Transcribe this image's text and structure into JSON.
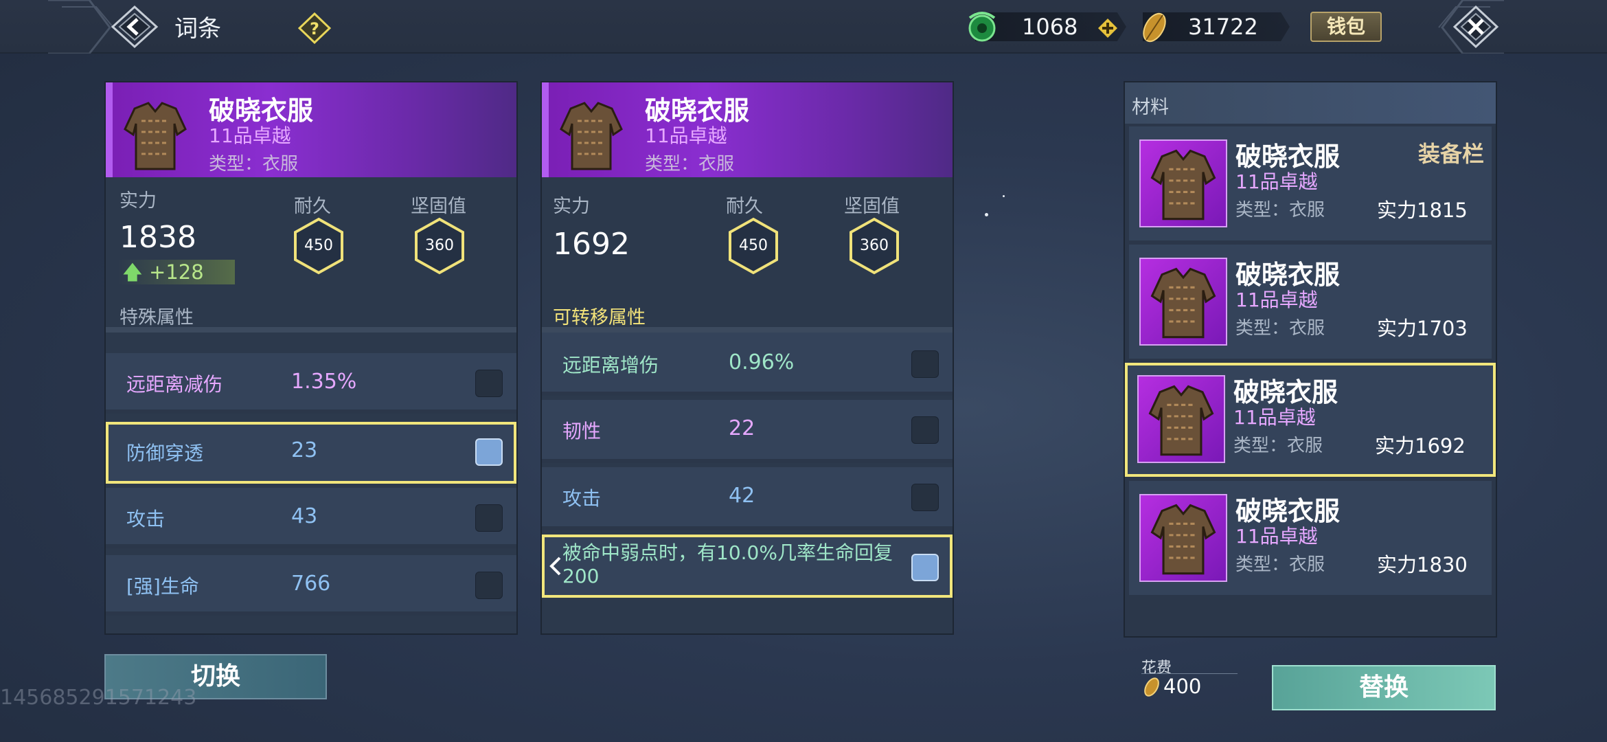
{
  "header": {
    "title": "词条",
    "currency_jade": "1068",
    "currency_gold": "31722",
    "wallet_label": "钱包",
    "icons": [
      "back-arrow-icon",
      "help-icon",
      "jade-coin-icon",
      "plus-icon",
      "gold-leaf-icon",
      "close-icon"
    ]
  },
  "left_panel": {
    "item_name": "破晓衣服",
    "grade": "11品卓越",
    "type": "类型：衣服",
    "power_label": "实力",
    "power_value": "1838",
    "power_diff": "+128",
    "durability_label": "耐久",
    "durability_value": "450",
    "solidity_label": "坚固值",
    "solidity_value": "360",
    "section_title": "特殊属性",
    "attributes": [
      {
        "name": "远距离减伤",
        "value": "1.35%",
        "checked": false
      },
      {
        "name": "防御穿透",
        "value": "23",
        "checked": true
      },
      {
        "name": "攻击",
        "value": "43",
        "checked": false
      },
      {
        "name": "[强]生命",
        "value": "766",
        "checked": false
      }
    ]
  },
  "middle_panel": {
    "item_name": "破晓衣服",
    "grade": "11品卓越",
    "type": "类型：衣服",
    "power_label": "实力",
    "power_value": "1692",
    "durability_label": "耐久",
    "durability_value": "450",
    "solidity_label": "坚固值",
    "solidity_value": "360",
    "section_title": "可转移属性",
    "attributes": [
      {
        "name": "远距离增伤",
        "value": "0.96%",
        "checked": false
      },
      {
        "name": "韧性",
        "value": "22",
        "checked": false
      },
      {
        "name": "攻击",
        "value": "42",
        "checked": false
      }
    ],
    "special_attribute": "被命中弱点时，有10.0%几率生命回复200"
  },
  "materials": {
    "title": "材料",
    "equipped_tag": "装备栏",
    "items": [
      {
        "name": "破晓衣服",
        "grade": "11品卓越",
        "type": "类型：衣服",
        "power": "实力1815"
      },
      {
        "name": "破晓衣服",
        "grade": "11品卓越",
        "type": "类型：衣服",
        "power": "实力1703"
      },
      {
        "name": "破晓衣服",
        "grade": "11品卓越",
        "type": "类型：衣服",
        "power": "实力1692"
      },
      {
        "name": "破晓衣服",
        "grade": "11品卓越",
        "type": "类型：衣服",
        "power": "实力1830"
      }
    ]
  },
  "footer": {
    "switch_label": "切换",
    "cost_label": "花费",
    "cost_value": "400",
    "replace_label": "替换",
    "watermark": "145685291571243"
  },
  "colors": {
    "highlight": "#f1e67c",
    "purple_header": "#8a2ed0",
    "grade_pink": "#e6a8ff",
    "value_blue": "#8fc1f2",
    "green_text": "#9fe6c8"
  }
}
